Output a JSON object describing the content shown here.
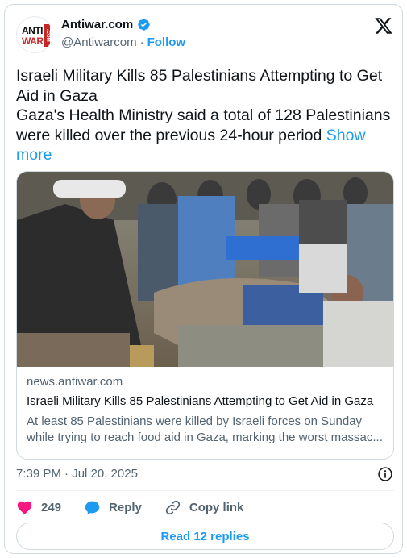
{
  "account": {
    "display_name": "Antiwar.com",
    "handle": "@Antiwarcom",
    "separator": "·",
    "follow_label": "Follow",
    "avatar_text_1": "ANTI",
    "avatar_text_2": "WAR",
    "avatar_text_3": ".COM",
    "verified": true
  },
  "tweet": {
    "line1": "Israeli Military Kills 85 Palestinians Attempting to Get Aid in Gaza",
    "line2": "Gaza's Health Ministry said a total of 128 Palestinians were killed over the previous 24-hour period",
    "show_more": "Show more",
    "timestamp": "7:39 PM · Jul 20, 2025"
  },
  "link_card": {
    "domain": "news.antiwar.com",
    "title": "Israeli Military Kills 85 Palestinians Attempting to Get Aid in Gaza",
    "description": "At least 85 Palestinians were killed by Israeli forces on Sunday while trying to reach food aid in Gaza, marking the worst massac..."
  },
  "actions": {
    "like_count": "249",
    "reply_label": "Reply",
    "copy_link_label": "Copy link"
  },
  "read_replies_label": "Read 12 replies",
  "colors": {
    "accent": "#1d9bf0",
    "like": "#f91880",
    "secondary_text": "#536471",
    "border": "#cfd9de"
  },
  "icons": [
    "verified-badge-icon",
    "x-logo-icon",
    "info-icon",
    "heart-icon",
    "reply-icon",
    "link-icon"
  ]
}
